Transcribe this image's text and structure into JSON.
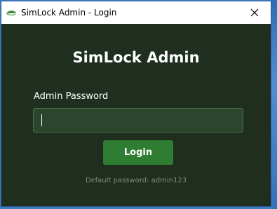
{
  "window": {
    "title": "SimLock Admin - Login",
    "app_icon": "leaf-icon",
    "close_icon": "close-icon"
  },
  "login": {
    "heading": "SimLock Admin",
    "password_label": "Admin Password",
    "password_value": "",
    "button_label": "Login",
    "hint": "Default password: admin123"
  },
  "colors": {
    "background": "#1f2e1f",
    "field_bg": "#2c462e",
    "button_bg": "#2e7d32",
    "hint_text": "#7f8f7f"
  }
}
